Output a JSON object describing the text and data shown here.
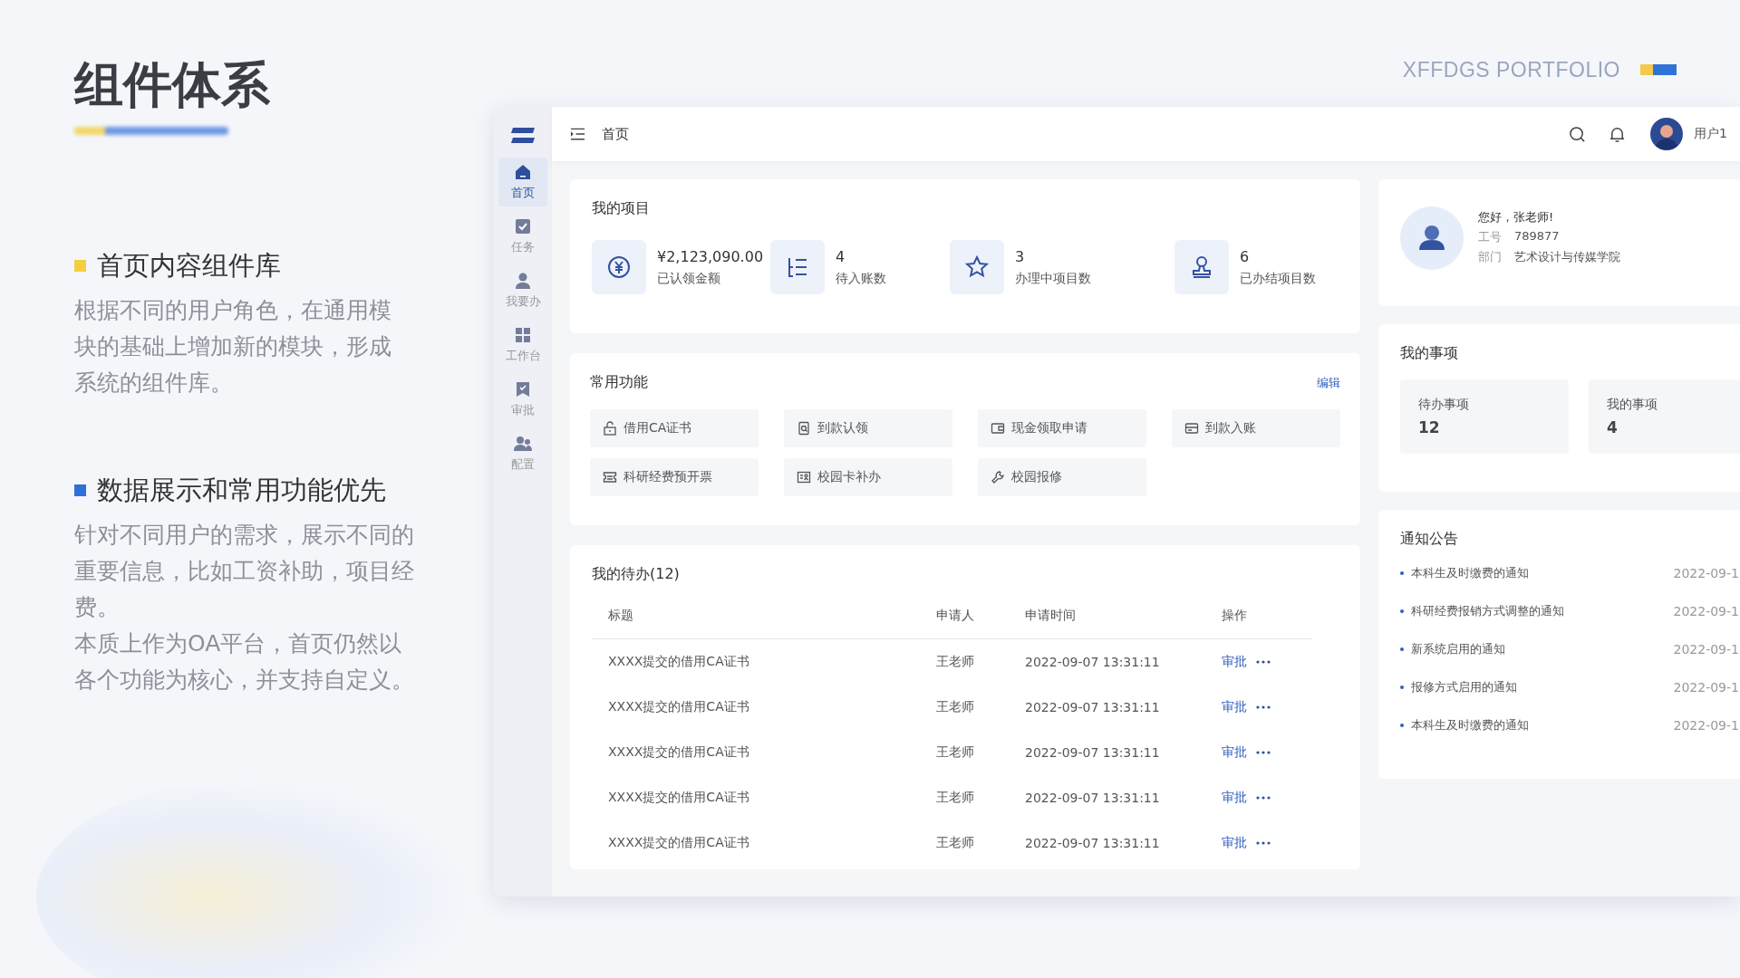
{
  "slide": {
    "title": "组件体系",
    "brand": "XFFDGS PORTFOLIO",
    "sections": [
      {
        "heading": "首页内容组件库",
        "color": "#f5cd3f",
        "paragraphs": [
          "根据不同的用户角色，在通用模块的基础上增加新的模块，形成系统的组件库。"
        ]
      },
      {
        "heading": "数据展示和常用功能优先",
        "color": "#2f6fd8",
        "paragraphs": [
          "针对不同用户的需求，展示不同的重要信息，比如工资补助，项目经费。",
          "本质上作为OA平台，首页仍然以各个功能为核心，并支持自定义。"
        ]
      }
    ]
  },
  "app": {
    "breadcrumb": "首页",
    "user": "用户1",
    "sidebar": [
      {
        "label": "首页",
        "kind": "home",
        "selected": true
      },
      {
        "label": "任务",
        "kind": "task",
        "selected": false
      },
      {
        "label": "我要办",
        "kind": "person",
        "selected": false
      },
      {
        "label": "工作台",
        "kind": "grid",
        "selected": false
      },
      {
        "label": "审批",
        "kind": "bookmark",
        "selected": false
      },
      {
        "label": "配置",
        "kind": "people",
        "selected": false
      }
    ],
    "projects": {
      "title": "我的项目",
      "stats": [
        {
          "kind": "yen",
          "value": "¥2,123,090.00",
          "label": "已认领金额"
        },
        {
          "kind": "list",
          "value": "4",
          "label": "待入账数"
        },
        {
          "kind": "star",
          "value": "3",
          "label": "办理中项目数"
        },
        {
          "kind": "stamp",
          "value": "6",
          "label": "已办结项目数"
        }
      ]
    },
    "shortcuts": {
      "title": "常用功能",
      "edit": "编辑",
      "items": [
        {
          "kind": "lock",
          "label": "借用CA证书"
        },
        {
          "kind": "doc",
          "label": "到款认领"
        },
        {
          "kind": "wallet",
          "label": "现金领取申请"
        },
        {
          "kind": "card",
          "label": "到款入账"
        },
        {
          "kind": "ticket",
          "label": "科研经费预开票"
        },
        {
          "kind": "idcard",
          "label": "校园卡补办"
        },
        {
          "kind": "wrench",
          "label": "校园报修"
        }
      ]
    },
    "todos": {
      "title": "我的待办(12)",
      "columns": [
        "标题",
        "申请人",
        "申请时间",
        "操作"
      ],
      "rows": [
        {
          "title": "XXXX提交的借用CA证书",
          "applicant": "王老师",
          "time": "2022-09-07 13:31:11",
          "action": "审批"
        },
        {
          "title": "XXXX提交的借用CA证书",
          "applicant": "王老师",
          "time": "2022-09-07 13:31:11",
          "action": "审批"
        },
        {
          "title": "XXXX提交的借用CA证书",
          "applicant": "王老师",
          "time": "2022-09-07 13:31:11",
          "action": "审批"
        },
        {
          "title": "XXXX提交的借用CA证书",
          "applicant": "王老师",
          "time": "2022-09-07 13:31:11",
          "action": "审批"
        },
        {
          "title": "XXXX提交的借用CA证书",
          "applicant": "王老师",
          "time": "2022-09-07 13:31:11",
          "action": "审批"
        }
      ]
    },
    "profile": {
      "greeting": "您好，张老师!",
      "fields": [
        {
          "label": "工号",
          "value": "789877"
        },
        {
          "label": "部门",
          "value": "艺术设计与传媒学院"
        }
      ]
    },
    "matters": {
      "title": "我的事项",
      "tiles": [
        {
          "label": "待办事项",
          "count": "12"
        },
        {
          "label": "我的事项",
          "count": "4"
        }
      ]
    },
    "notices": {
      "title": "通知公告",
      "items": [
        {
          "title": "本科生及时缴费的通知",
          "date": "2022-09-1"
        },
        {
          "title": "科研经费报销方式调整的通知",
          "date": "2022-09-1"
        },
        {
          "title": "新系统启用的通知",
          "date": "2022-09-1"
        },
        {
          "title": "报修方式启用的通知",
          "date": "2022-09-1"
        },
        {
          "title": "本科生及时缴费的通知",
          "date": "2022-09-1"
        }
      ]
    }
  }
}
